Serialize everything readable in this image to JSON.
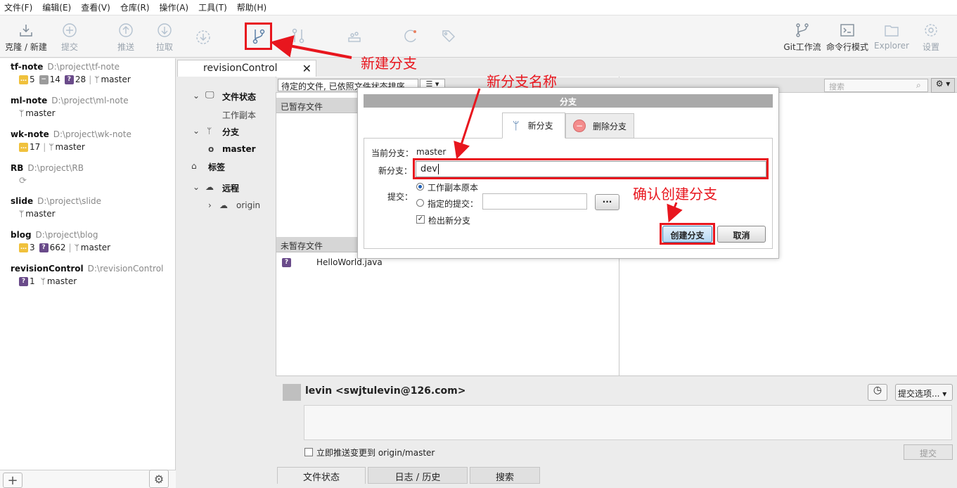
{
  "menu": [
    "文件(F)",
    "编辑(E)",
    "查看(V)",
    "仓库(R)",
    "操作(A)",
    "工具(T)",
    "帮助(H)"
  ],
  "toolbar": {
    "clone": "克隆 / 新建",
    "commit": "提交",
    "push": "推送",
    "pull": "拉取",
    "gitflow": "Git工作流",
    "terminal": "命令行模式",
    "explorer": "Explorer",
    "settings": "设置"
  },
  "repos": [
    {
      "name": "tf-note",
      "path": "D:\\project\\tf-note",
      "modified": "5",
      "deleted": "14",
      "unknown": "28",
      "branch": "master"
    },
    {
      "name": "ml-note",
      "path": "D:\\project\\ml-note",
      "branch": "master"
    },
    {
      "name": "wk-note",
      "path": "D:\\project\\wk-note",
      "modified": "17",
      "branch": "master"
    },
    {
      "name": "RB",
      "path": "D:\\project\\RB"
    },
    {
      "name": "slide",
      "path": "D:\\project\\slide",
      "branch": "master"
    },
    {
      "name": "blog",
      "path": "D:\\project\\blog",
      "modified": "3",
      "unknown": "662",
      "branch": "master"
    },
    {
      "name": "revisionControl",
      "path": "D:\\revisionControl",
      "unknown": "1",
      "branch": "master"
    }
  ],
  "tab": {
    "title": "revisionControl",
    "close": "✕"
  },
  "tree": {
    "file_status": "文件状态",
    "working_copy": "工作副本",
    "branches": "分支",
    "branch_master": "master",
    "tags": "标签",
    "remotes": "远程",
    "origin": "origin"
  },
  "filter": {
    "select": "待定的文件, 已依照文件状态排序",
    "search_placeholder": "搜索"
  },
  "panels": {
    "staged": "已暂存文件",
    "unstaged": "未暂存文件",
    "unstaged_files": [
      "HelloWorld.java"
    ]
  },
  "commit_area": {
    "author": "levin <swjtulevin@126.com>",
    "options": "提交选项...",
    "push_now": "立即推送变更到 origin/master",
    "commit_btn": "提交"
  },
  "bottom_tabs": [
    "文件状态",
    "日志 / 历史",
    "搜索"
  ],
  "dialog": {
    "title": "分支",
    "tab_new": "新分支",
    "tab_delete": "删除分支",
    "current_label": "当前分支：",
    "current_value": "master",
    "new_label": "新分支：",
    "new_value": "dev",
    "commit_label": "提交：",
    "opt_working": "工作副本原本",
    "opt_specified": "指定的提交：",
    "dots": "...",
    "checkout": "检出新分支",
    "create": "创建分支",
    "cancel": "取消"
  },
  "annotations": {
    "new_branch": "新建分支",
    "branch_name": "新分支名称",
    "confirm": "确认创建分支"
  },
  "colors": {
    "annotation": "#e8161e",
    "accent": "#1d5fb8",
    "mod_badge": "#f0c13c",
    "unknown_badge": "#6a4b8a"
  }
}
